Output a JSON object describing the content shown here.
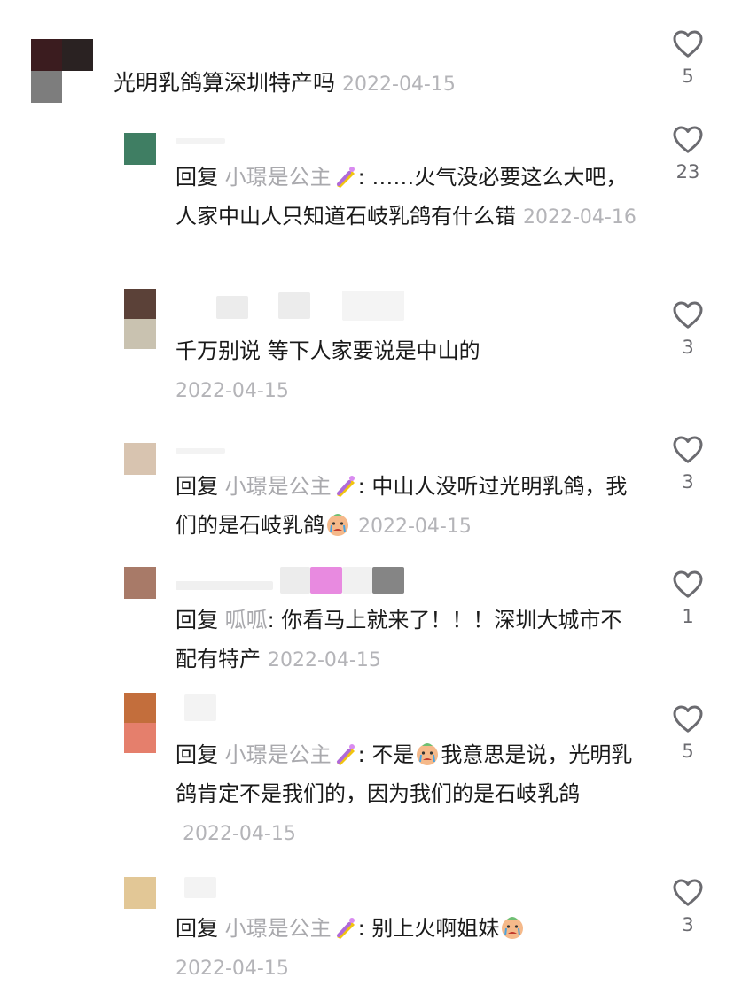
{
  "colors": {
    "text": "#1a1a1a",
    "muted": "#a9a9ad",
    "time": "#b4b4b8",
    "heart": "#6b6b70"
  },
  "icons": {
    "like": "heart-outline-icon",
    "nail": "nail-polish-emoji",
    "cry": "crying-face-emoji"
  },
  "comments": [
    {
      "text": "光明乳鸽算深圳特产吗",
      "time": "2022-04-15",
      "likes": "5"
    },
    {
      "reply_kw": "回复",
      "reply_to": "小璟是公主",
      "text": ": ……火气没必要这么大吧，人家中山人只知道石岐乳鸽有什么错",
      "time": "2022-04-16",
      "likes": "23"
    },
    {
      "text": "千万别说 等下人家要说是中山的",
      "time": "2022-04-15",
      "likes": "3"
    },
    {
      "reply_kw": "回复",
      "reply_to": "小璟是公主",
      "text": ": 中山人没听过光明乳鸽，我们的是石岐乳鸽",
      "time": "2022-04-15",
      "likes": "3"
    },
    {
      "reply_kw": "回复",
      "reply_to": "呱呱",
      "text": ": 你看马上就来了！！！深圳大城市不配有特产",
      "time": "2022-04-15",
      "likes": "1"
    },
    {
      "reply_kw": "回复",
      "reply_to": "小璟是公主",
      "text_a": ": 不是",
      "text_b": "我意思是说，光明乳鸽肯定不是我们的，因为我们的是石岐乳鸽",
      "time": "2022-04-15",
      "likes": "5"
    },
    {
      "reply_kw": "回复",
      "reply_to": "小璟是公主",
      "text": ": 别上火啊姐妹",
      "time": "2022-04-15",
      "likes": "3"
    }
  ]
}
